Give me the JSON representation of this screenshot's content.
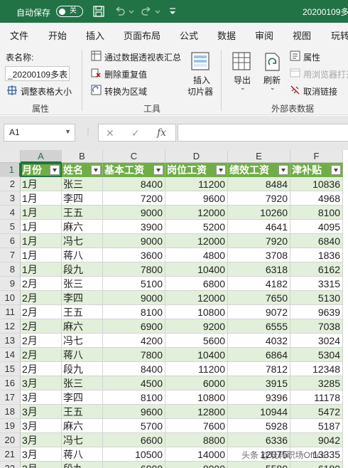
{
  "titlebar": {
    "autosave_label": "自动保存",
    "autosave_state": "关",
    "filename": "20200109多"
  },
  "menu": [
    "文件",
    "开始",
    "插入",
    "页面布局",
    "公式",
    "数据",
    "审阅",
    "视图",
    "玩转"
  ],
  "ribbon": {
    "table_name_label": "表名称:",
    "table_name_value": "_20200109多表",
    "resize_table": "调整表格大小",
    "group_properties": "属性",
    "pivot_summary": "通过数据透视表汇总",
    "remove_duplicates": "删除重复值",
    "convert_to_range": "转换为区域",
    "group_tools": "工具",
    "insert_slicer": [
      "插入",
      "切片器"
    ],
    "export": "导出",
    "refresh": "刷新",
    "properties": "属性",
    "open_in_browser": "用浏览器打开",
    "unlink": "取消链接",
    "group_external": "外部表数据"
  },
  "formula_bar": {
    "name_box": "A1",
    "fx_label": "fx",
    "formula": ""
  },
  "grid": {
    "columns": [
      "A",
      "B",
      "C",
      "D",
      "E",
      "F"
    ],
    "headers": [
      "月份",
      "姓名",
      "基本工资",
      "岗位工资",
      "绩效工资",
      "津补贴"
    ],
    "rows": [
      [
        "1月",
        "张三",
        "8400",
        "11200",
        "8484",
        "10836"
      ],
      [
        "1月",
        "李四",
        "7200",
        "9600",
        "7920",
        "4968"
      ],
      [
        "1月",
        "王五",
        "9000",
        "12000",
        "10260",
        "8100"
      ],
      [
        "1月",
        "麻六",
        "3900",
        "5200",
        "4641",
        "4095"
      ],
      [
        "1月",
        "冯七",
        "9000",
        "12000",
        "7920",
        "6840"
      ],
      [
        "1月",
        "蒋八",
        "3600",
        "4800",
        "3708",
        "1836"
      ],
      [
        "1月",
        "段九",
        "7800",
        "10400",
        "6318",
        "6162"
      ],
      [
        "2月",
        "张三",
        "5100",
        "6800",
        "4182",
        "3315"
      ],
      [
        "2月",
        "李四",
        "9000",
        "12000",
        "7650",
        "5130"
      ],
      [
        "2月",
        "王五",
        "8100",
        "10800",
        "9072",
        "9639"
      ],
      [
        "2月",
        "麻六",
        "6900",
        "9200",
        "6555",
        "7038"
      ],
      [
        "2月",
        "冯七",
        "4200",
        "5600",
        "4032",
        "3024"
      ],
      [
        "2月",
        "蒋八",
        "7800",
        "10400",
        "6864",
        "5304"
      ],
      [
        "2月",
        "段九",
        "8400",
        "11200",
        "7812",
        "12348"
      ],
      [
        "3月",
        "张三",
        "4500",
        "6000",
        "3915",
        "3285"
      ],
      [
        "3月",
        "李四",
        "8100",
        "10800",
        "9396",
        "11178"
      ],
      [
        "3月",
        "王五",
        "9600",
        "12800",
        "10944",
        "5472"
      ],
      [
        "3月",
        "麻六",
        "5700",
        "7600",
        "5928",
        "5187"
      ],
      [
        "3月",
        "冯七",
        "6600",
        "8800",
        "6336",
        "9042"
      ],
      [
        "3月",
        "蒋八",
        "10500",
        "14000",
        "12075",
        "13335"
      ],
      [
        "3月",
        "段九",
        "6000",
        "8000",
        "5580",
        "6180"
      ]
    ],
    "row_numbers": [
      "1",
      "2",
      "3",
      "4",
      "5",
      "6",
      "7",
      "8",
      "9",
      "10",
      "11",
      "12",
      "13",
      "14",
      "15",
      "16",
      "17",
      "18",
      "19",
      "20",
      "21",
      "22",
      "23"
    ]
  },
  "watermark": "头条 @玩转职场Office",
  "colors": {
    "excel_green": "#217346",
    "table_header": "#70ad47",
    "band": "#e2efda"
  }
}
